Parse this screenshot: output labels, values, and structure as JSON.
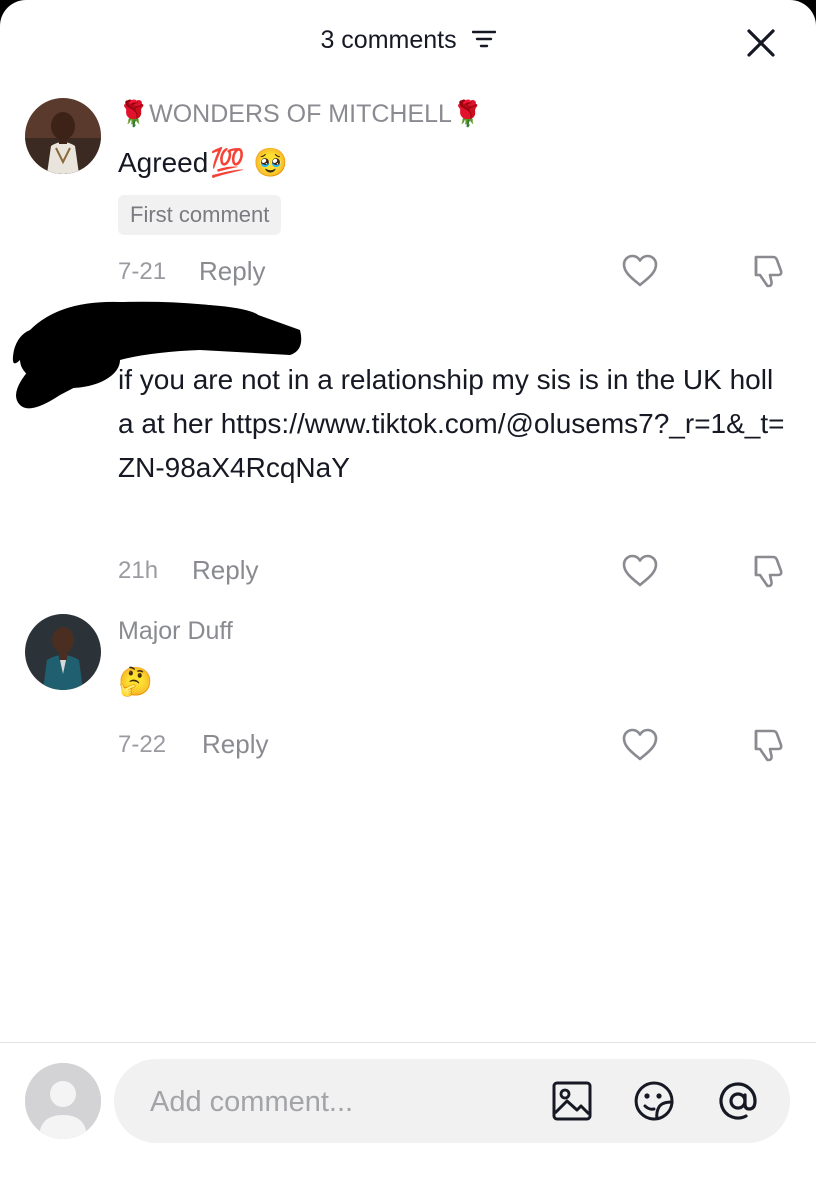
{
  "header": {
    "title": "3 comments",
    "filter_icon": "filter-lines-icon",
    "close_icon": "close-icon"
  },
  "comments": [
    {
      "username": "WONDERS OF MITCHELL",
      "username_prefix_emoji": "🌹",
      "username_suffix_emoji": "🌹",
      "text": "Agreed",
      "text_emoji": "💯 🥹",
      "badge": "First comment",
      "date": "7-21",
      "reply": "Reply"
    },
    {
      "username": "",
      "text": "if you are not in a relationship my sis is in the UK holla at her https://www.tiktok.com/@olusems7?_r=1&_t=ZN-98aX4RcqNaY",
      "date": "21h",
      "reply": "Reply"
    },
    {
      "username": "Major Duff",
      "text": "🤔",
      "date": "7-22",
      "reply": "Reply"
    }
  ],
  "footer": {
    "input_placeholder": "Add comment...",
    "icons": [
      "image-icon",
      "emoji-sticker-icon",
      "mention-at-icon"
    ]
  },
  "colors": {
    "text_primary": "#161823",
    "text_secondary": "#8a8b91",
    "background": "#ffffff",
    "input_bg": "#f1f1f2"
  }
}
